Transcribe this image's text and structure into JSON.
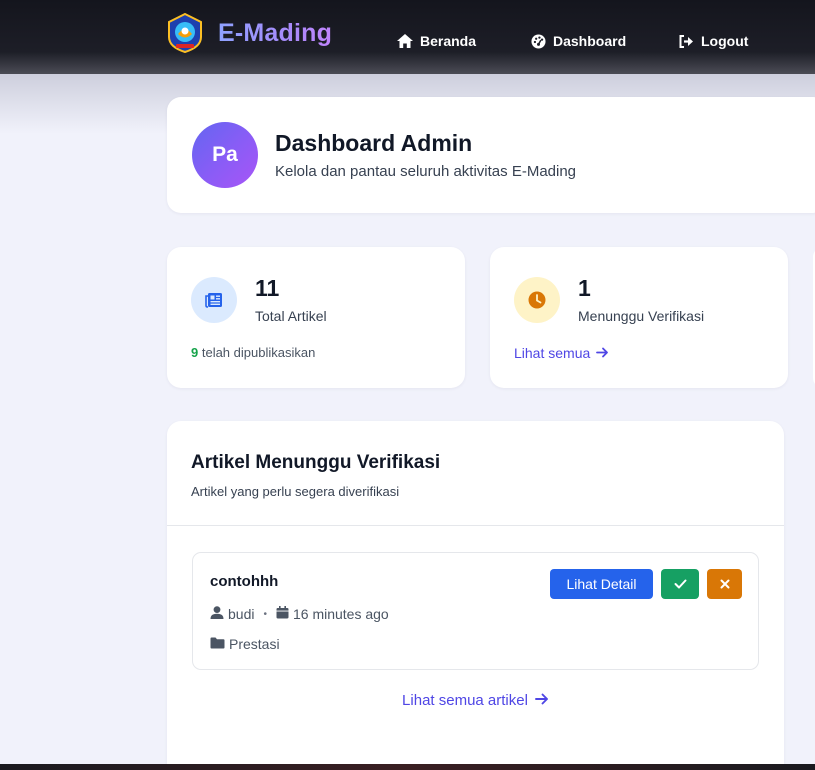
{
  "navbar": {
    "brand": "E-Mading",
    "links": [
      {
        "label": "Beranda",
        "icon": "home-icon"
      },
      {
        "label": "Dashboard",
        "icon": "dashboard-icon"
      },
      {
        "label": "Logout",
        "icon": "logout-icon"
      }
    ]
  },
  "header": {
    "avatar_initials": "Pa",
    "title": "Dashboard Admin",
    "subtitle": "Kelola dan pantau seluruh aktivitas E-Mading"
  },
  "stats": [
    {
      "value": "11",
      "label": "Total Artikel",
      "footer_count": "9",
      "footer_text": " telah dipublikasikan",
      "icon": "newspaper-icon",
      "icon_color": "#2563eb",
      "icon_bg": "#dbeafe"
    },
    {
      "value": "1",
      "label": "Menunggu Verifikasi",
      "link_label": "Lihat semua",
      "icon": "clock-icon",
      "icon_color": "#d97706",
      "icon_bg": "#fef3c7"
    }
  ],
  "pending": {
    "title": "Artikel Menunggu Verifikasi",
    "subtitle": "Artikel yang perlu segera diverifikasi",
    "articles": [
      {
        "title": "contohhh",
        "author": "budi",
        "time": "16 minutes ago",
        "category": "Prestasi",
        "detail_label": "Lihat Detail"
      }
    ],
    "all_link": "Lihat semua artikel"
  },
  "colors": {
    "accent": "#4f46e5",
    "primary_button": "#2563eb",
    "approve_button": "#16a063",
    "reject_button": "#d97706",
    "published_count": "#16a34a"
  }
}
